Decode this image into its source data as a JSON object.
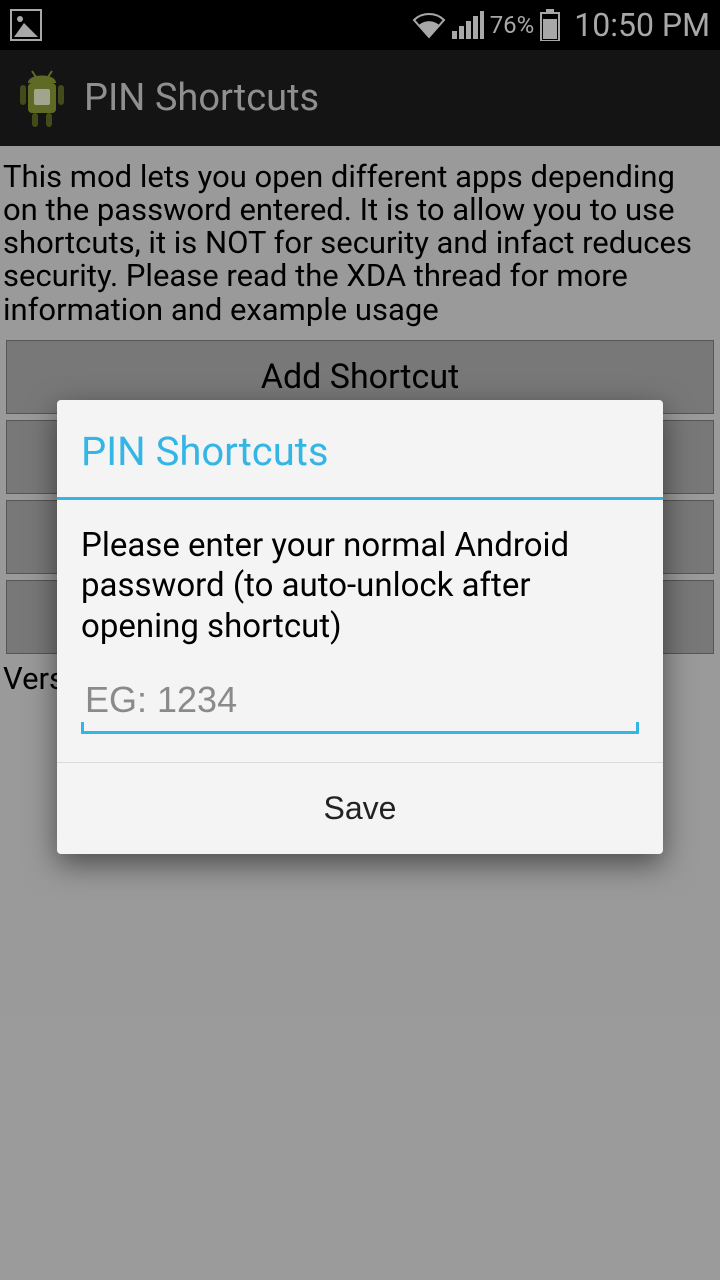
{
  "status": {
    "battery_pct": "76%",
    "time": "10:50 PM"
  },
  "actionbar": {
    "title": "PIN Shortcuts"
  },
  "main": {
    "description": "This mod lets you open different apps depending on the password entered. It is to allow you to use shortcuts, it is NOT for security and infact reduces security. Please read the XDA thread for more information and example usage",
    "buttons": [
      {
        "label": "Add Shortcut"
      },
      {
        "label": ""
      },
      {
        "label": ""
      },
      {
        "label": ""
      }
    ],
    "version_label_prefix": "Vers"
  },
  "dialog": {
    "title": "PIN Shortcuts",
    "message": "Please enter your normal Android password (to auto-unlock after opening shortcut)",
    "input_placeholder": "EG: 1234",
    "input_value": "",
    "save_label": "Save"
  },
  "colors": {
    "holo_blue": "#33b5e5"
  }
}
